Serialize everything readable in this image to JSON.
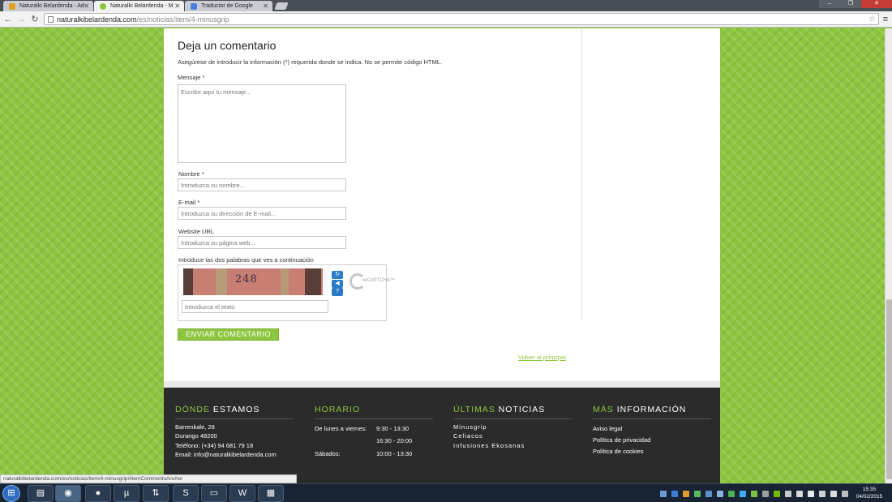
{
  "browser": {
    "tabs": [
      {
        "title": "Naturalki Belardenda - Ad",
        "active": false,
        "icon_color": "#e0a21c"
      },
      {
        "title": "Naturalki Belardenda - M",
        "active": true,
        "icon_color": "#8cc63f"
      },
      {
        "title": "Traductor de Google",
        "active": false,
        "icon_color": "#4a7fe0"
      }
    ],
    "url_host": "naturalkibelardenda.com",
    "url_path": "/es/noticias/item/4-minusgrip",
    "status_url": "naturalkibelardenda.com/es/noticias/item/4-minusgrip#itemCommentsAnchor"
  },
  "form": {
    "title": "Deja un comentario",
    "note": "Asegúrese de introducir la información (*) requerida donde se indica. No se permite código HTML.",
    "message_label": "Mensaje *",
    "message_placeholder": "Escribe aquí tu mensaje...",
    "name_label": "Nombre *",
    "name_placeholder": "Introduzca su nombre...",
    "email_label": "E-mail *",
    "email_placeholder": "Introduzca su dirección de E-mail...",
    "website_label": "Website URL",
    "website_placeholder": "Introduzca su página web...",
    "captcha_label": "Introduce las dos palabras que ves a continuación",
    "captcha_word": "248",
    "captcha_placeholder": "Introduzca el texto",
    "captcha_logo_text": "reCAPTCHA™",
    "submit_label": "ENVIAR COMENTARIO",
    "back_to_top": "Volver al principio"
  },
  "footer": {
    "where": {
      "title_accent": "DÓNDE",
      "title_rest": "ESTAMOS",
      "lines": [
        "Barrenkale, 28",
        "Durango 48200",
        "Teléfono: (+34) 94 681 79 18",
        "Email: info@naturalkibelardenda.com"
      ]
    },
    "hours": {
      "title_accent": "HORARIO",
      "title_rest": "",
      "weekday_label": "De lunes a viernes:",
      "weekday_am": "9:30 - 13:30",
      "weekday_pm": "16:30 - 20:00",
      "saturday_label": "Sábados:",
      "saturday_hours": "10:00 - 13:30"
    },
    "news": {
      "title_accent": "ÚLTIMAS",
      "title_rest": "NOTICIAS",
      "items": [
        "Minusgrip",
        "Celiacos",
        "Infusiones Ekosanas"
      ]
    },
    "info": {
      "title_accent": "MÁS",
      "title_rest": "INFORMACIÓN",
      "items": [
        "Aviso legal",
        "Política de privacidad",
        "Política de cookies"
      ]
    }
  },
  "taskbar": {
    "time": "15:35",
    "date": "04/02/2015",
    "apps": [
      "explorer",
      "chrome",
      "firefox",
      "utorrent",
      "transfer",
      "skype",
      "folder",
      "word",
      "desktop"
    ]
  },
  "colors": {
    "accent": "#8cc63f",
    "footer_bg": "#2b2b2b"
  }
}
